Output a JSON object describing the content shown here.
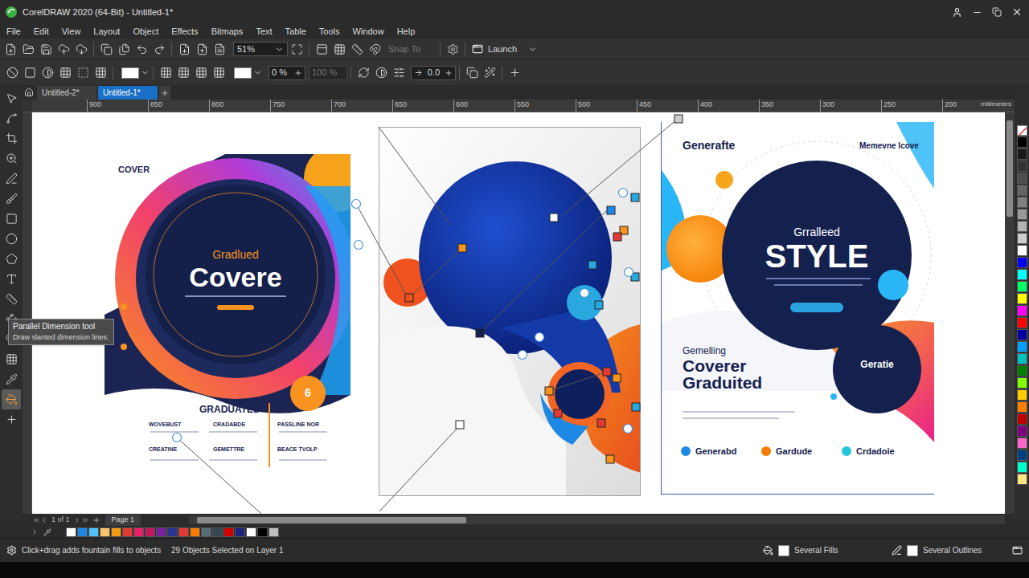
{
  "window": {
    "title": "CorelDRAW 2020 (64-Bit) - Untitled-1*"
  },
  "menu": [
    "File",
    "Edit",
    "View",
    "Layout",
    "Object",
    "Effects",
    "Bitmaps",
    "Text",
    "Table",
    "Tools",
    "Window",
    "Help"
  ],
  "toolbar": {
    "zoom": "51%",
    "snap": {
      "label": "Snap To",
      "disabled": true
    },
    "launch": "Launch"
  },
  "property_bar": {
    "transparency": "0 %",
    "opacity": {
      "value": "100 %",
      "disabled": true
    },
    "angle": "0.0"
  },
  "doc_tabs": [
    {
      "label": "Untitled-2*",
      "selected": false
    },
    {
      "label": "Untitled-1*",
      "selected": true
    }
  ],
  "ruler": {
    "ticks": [
      "900",
      "850",
      "800",
      "750",
      "700",
      "650",
      "600",
      "550",
      "500",
      "450",
      "400",
      "350",
      "300",
      "250",
      "200"
    ],
    "unit": "millimeters"
  },
  "tools": [
    {
      "selected": false
    },
    {
      "selected": false
    },
    {
      "selected": false
    },
    {
      "selected": false
    },
    {
      "selected": false
    },
    {
      "selected": false
    },
    {
      "selected": false
    },
    {
      "selected": false
    },
    {
      "selected": false
    },
    {
      "selected": false
    },
    {
      "selected": false
    },
    {
      "selected": false
    },
    {
      "selected": false
    },
    {
      "selected": false
    },
    {
      "selected": false
    },
    {
      "selected": true
    },
    {
      "selected": false
    }
  ],
  "tooltip": {
    "title": "Parallel Dimension tool",
    "description": "Draw slanted dimension lines."
  },
  "poster_left": {
    "tag": "COVER",
    "subtitle": "Gradlued",
    "title": "Covere",
    "badge": "6",
    "heading": "GRADUATED",
    "columns": [
      "WOVEBUST",
      "CRADABDE",
      "PASSLINE NOR",
      "CREATINE",
      "GEMETTRE",
      "BEACE TVOLP"
    ]
  },
  "poster_right": {
    "brand": "Generafte",
    "tagline": "Memevne Icove",
    "kicker": "Grralleed",
    "headline": "STYLE",
    "intro": "Gemelling",
    "title_lines": [
      "Coverer",
      "Graduited"
    ],
    "badge": "Geratie",
    "features": [
      {
        "label": "Generabd",
        "color": "#1e88e5"
      },
      {
        "label": "Gardude",
        "color": "#f57c00"
      },
      {
        "label": "Crdadoie",
        "color": "#26c6da"
      }
    ]
  },
  "page_nav": {
    "counter": "1 of 1",
    "page_tab": "Page 1"
  },
  "palette_bottom": [
    {
      "color": "#ffffff"
    },
    {
      "color": "#1e88e5"
    },
    {
      "color": "#4fc3f7"
    },
    {
      "color": "#f6c46a"
    },
    {
      "color": "#f39c12"
    },
    {
      "color": "#e53935"
    },
    {
      "color": "#e91e63"
    },
    {
      "color": "#c2185b"
    },
    {
      "color": "#7b1fa2"
    },
    {
      "color": "#283593"
    },
    {
      "color": "#e53935"
    },
    {
      "color": "#f57c00"
    },
    {
      "color": "#546e7a"
    },
    {
      "color": "#37474f"
    },
    {
      "color": "#d50000"
    },
    {
      "color": "#1a237e"
    },
    {
      "color": "#ffffff"
    },
    {
      "color": "#000000"
    },
    {
      "color": "#bdbdbd"
    }
  ],
  "palette_right": [
    {
      "kind": "none",
      "color": "#ffffff"
    },
    {
      "kind": "swatch",
      "color": "#000000"
    },
    {
      "kind": "swatch",
      "color": "#1a1a1a"
    },
    {
      "kind": "swatch",
      "color": "#333333"
    },
    {
      "kind": "swatch",
      "color": "#4d4d4d"
    },
    {
      "kind": "swatch",
      "color": "#666666"
    },
    {
      "kind": "swatch",
      "color": "#808080"
    },
    {
      "kind": "swatch",
      "color": "#999999"
    },
    {
      "kind": "swatch",
      "color": "#b3b3b3"
    },
    {
      "kind": "swatch",
      "color": "#cccccc"
    },
    {
      "kind": "swatch",
      "color": "#ffffff"
    },
    {
      "kind": "swatch",
      "color": "#0000ff"
    },
    {
      "kind": "swatch",
      "color": "#00ffff"
    },
    {
      "kind": "swatch",
      "color": "#00ff66"
    },
    {
      "kind": "swatch",
      "color": "#ffff00"
    },
    {
      "kind": "swatch",
      "color": "#ff00ff"
    },
    {
      "kind": "swatch",
      "color": "#ff0000"
    },
    {
      "kind": "swatch",
      "color": "#0000a0"
    },
    {
      "kind": "swatch",
      "color": "#00a0ff"
    },
    {
      "kind": "swatch",
      "color": "#00c0c0"
    },
    {
      "kind": "swatch",
      "color": "#008000"
    },
    {
      "kind": "swatch",
      "color": "#80ff00"
    },
    {
      "kind": "swatch",
      "color": "#ffcc00"
    },
    {
      "kind": "swatch",
      "color": "#ff8000"
    },
    {
      "kind": "swatch",
      "color": "#c00000"
    },
    {
      "kind": "swatch",
      "color": "#800080"
    },
    {
      "kind": "swatch",
      "color": "#ff66cc"
    },
    {
      "kind": "swatch",
      "color": "#004080"
    },
    {
      "kind": "swatch",
      "color": "#00ffcc"
    },
    {
      "kind": "swatch",
      "color": "#ffe680"
    }
  ],
  "status_bar": {
    "hint": "Click+drag adds fountain fills to objects",
    "selection": "29 Objects Selected on Layer 1",
    "fill": "Several Fills",
    "outline": "Several Outlines"
  }
}
